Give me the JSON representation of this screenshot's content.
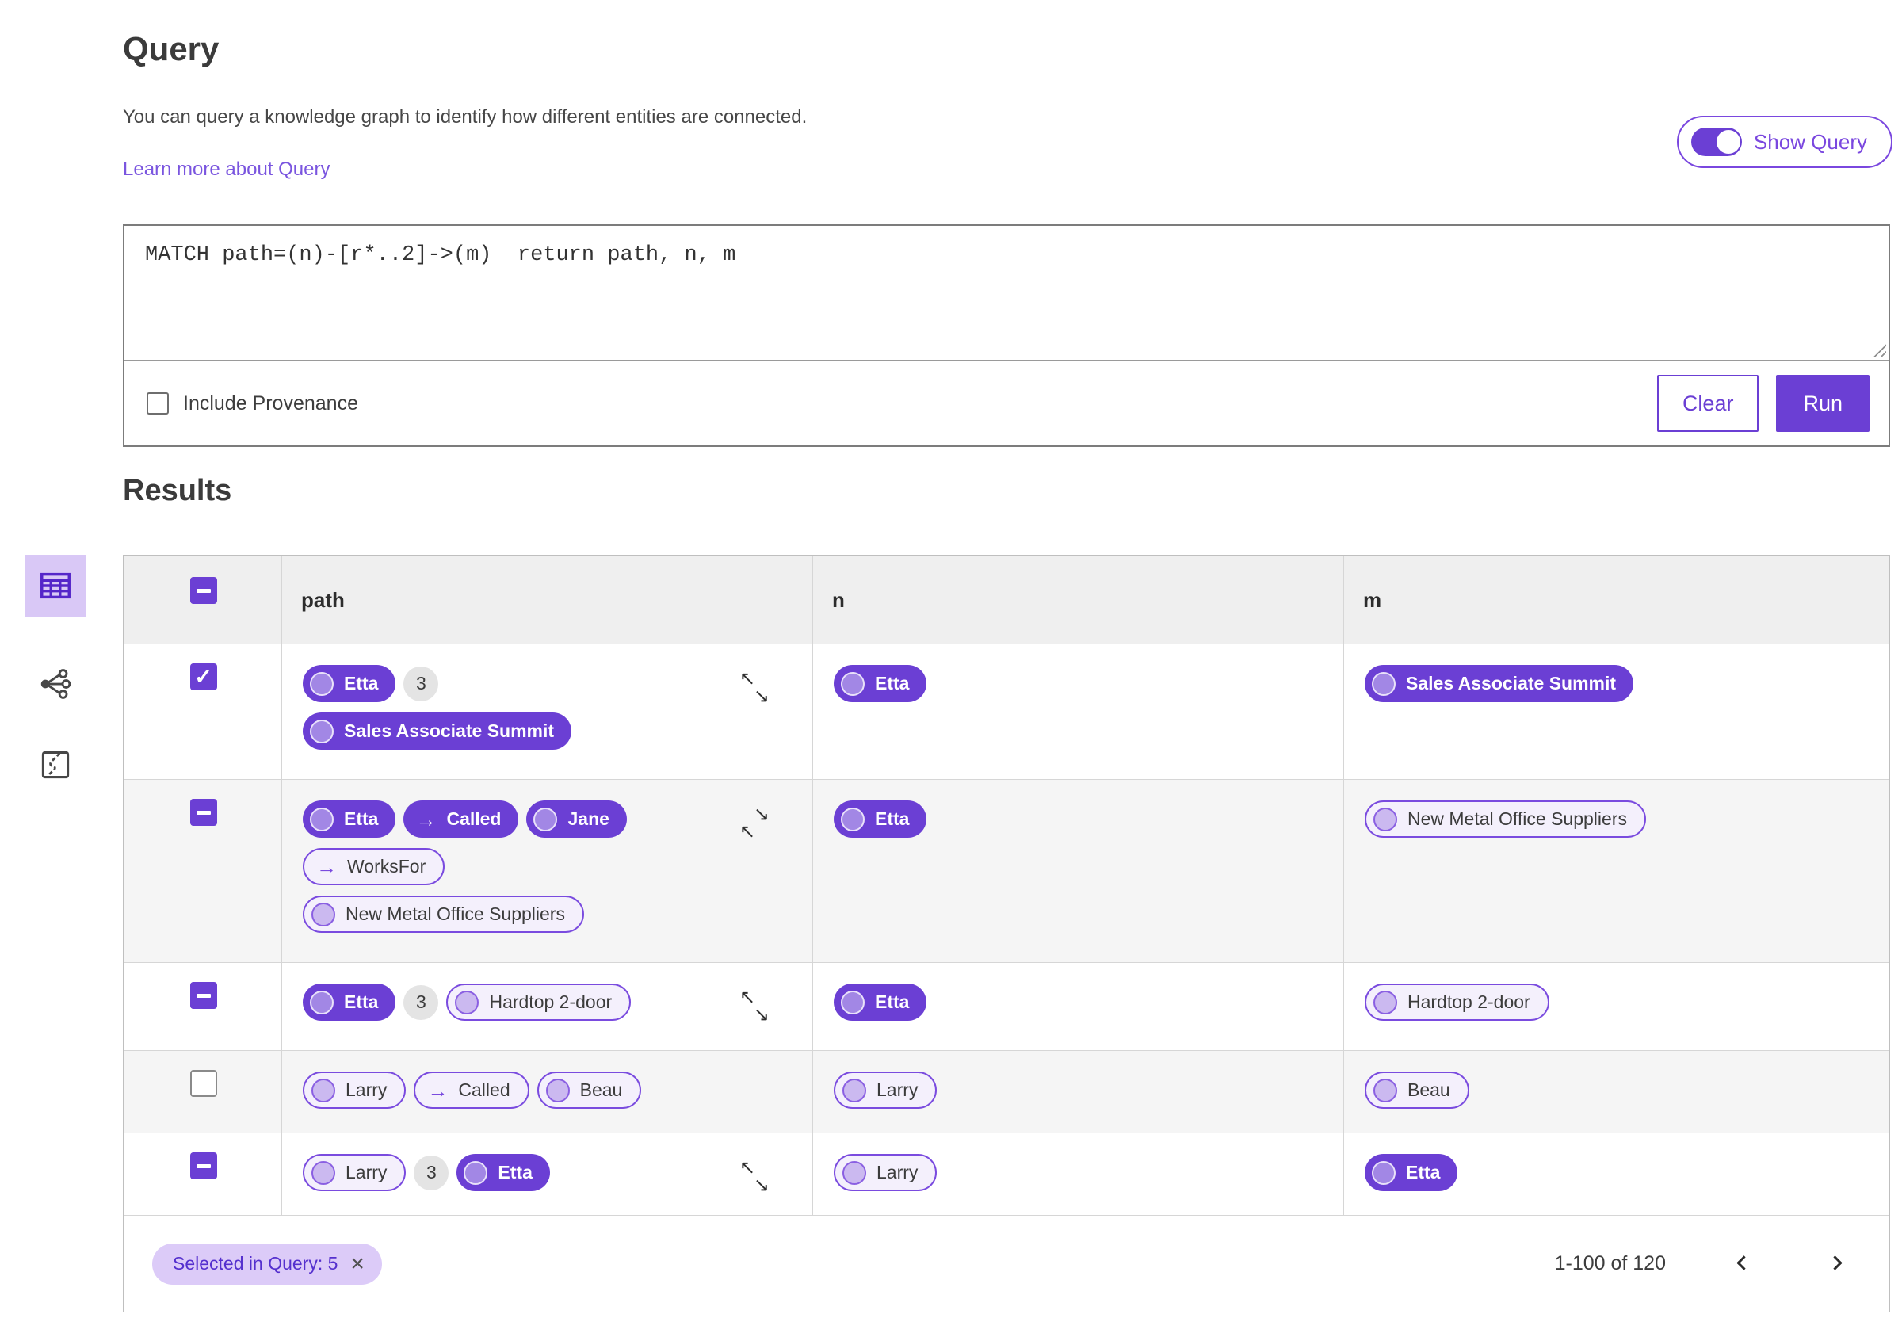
{
  "header": {
    "title": "Query",
    "description": "You can query a knowledge graph to identify how different entities are connected.",
    "learn_more": "Learn more about Query",
    "show_query_label": "Show Query",
    "show_query_on": true
  },
  "query_editor": {
    "text": "MATCH path=(n)-[r*..2]->(m)  return path, n, m",
    "include_provenance_label": "Include Provenance",
    "include_provenance_checked": false,
    "clear_label": "Clear",
    "run_label": "Run"
  },
  "results": {
    "title": "Results",
    "active_view": "table-view",
    "view_modes": [
      "table-view",
      "graph-view",
      "map-view"
    ],
    "columns": [
      "path",
      "n",
      "m"
    ],
    "header_checkbox": "indeterminate",
    "rows": [
      {
        "checkbox": "checked",
        "path_lines": [
          [
            {
              "t": "node",
              "v": "filled",
              "label": "Etta"
            },
            {
              "t": "count",
              "label": "3"
            }
          ],
          [
            {
              "t": "node",
              "v": "filled",
              "label": "Sales Associate Summit"
            }
          ]
        ],
        "resize_icon": "expand",
        "n": {
          "t": "node",
          "v": "filled",
          "label": "Etta"
        },
        "m": {
          "t": "node",
          "v": "filled",
          "label": "Sales Associate Summit"
        }
      },
      {
        "checkbox": "indeterminate",
        "path_lines": [
          [
            {
              "t": "node",
              "v": "filled",
              "label": "Etta"
            },
            {
              "t": "edge",
              "v": "filled",
              "label": "Called"
            },
            {
              "t": "node",
              "v": "filled",
              "label": "Jane"
            }
          ],
          [
            {
              "t": "edge",
              "v": "outlined",
              "label": "WorksFor"
            }
          ],
          [
            {
              "t": "node",
              "v": "outlined",
              "label": "New Metal Office Suppliers"
            }
          ]
        ],
        "resize_icon": "collapse",
        "n": {
          "t": "node",
          "v": "filled",
          "label": "Etta"
        },
        "m": {
          "t": "node",
          "v": "outlined",
          "label": "New Metal Office Suppliers"
        }
      },
      {
        "checkbox": "indeterminate",
        "path_lines": [
          [
            {
              "t": "node",
              "v": "filled",
              "label": "Etta"
            },
            {
              "t": "count",
              "label": "3"
            },
            {
              "t": "node",
              "v": "outlined",
              "label": "Hardtop 2-door"
            }
          ]
        ],
        "resize_icon": "expand",
        "n": {
          "t": "node",
          "v": "filled",
          "label": "Etta"
        },
        "m": {
          "t": "node",
          "v": "outlined",
          "label": "Hardtop 2-door"
        }
      },
      {
        "checkbox": "unchecked",
        "path_lines": [
          [
            {
              "t": "node",
              "v": "outlined",
              "label": "Larry"
            },
            {
              "t": "edge",
              "v": "outlined",
              "label": "Called"
            },
            {
              "t": "node",
              "v": "outlined",
              "label": "Beau"
            }
          ]
        ],
        "resize_icon": null,
        "n": {
          "t": "node",
          "v": "outlined",
          "label": "Larry"
        },
        "m": {
          "t": "node",
          "v": "outlined",
          "label": "Beau"
        }
      },
      {
        "checkbox": "indeterminate",
        "path_lines": [
          [
            {
              "t": "node",
              "v": "outlined",
              "label": "Larry"
            },
            {
              "t": "count",
              "label": "3"
            },
            {
              "t": "node",
              "v": "filled",
              "label": "Etta"
            }
          ]
        ],
        "resize_icon": "expand",
        "n": {
          "t": "node",
          "v": "outlined",
          "label": "Larry"
        },
        "m": {
          "t": "node",
          "v": "filled",
          "label": "Etta"
        }
      },
      {
        "partial": true,
        "checkbox": "none",
        "path_lines": [
          [
            {
              "t": "node",
              "v": "outlined",
              "label": ""
            },
            {
              "t": "count",
              "label": ""
            },
            {
              "t": "node",
              "v": "outlined",
              "label": ""
            }
          ]
        ],
        "resize_icon": null,
        "n": {
          "t": "node",
          "v": "outlined",
          "label": ""
        },
        "m": {
          "t": "node",
          "v": "outlined",
          "label": ""
        }
      }
    ],
    "footer": {
      "selected_chip": "Selected in Query: 5",
      "page_range": "1-100 of 120"
    }
  },
  "icons": {
    "edge_arrow": "→",
    "check": "✓",
    "arrow_nw": "↖",
    "arrow_se": "↘",
    "dismiss": "×"
  },
  "palette": {
    "primary_purple": "#6B3FD4",
    "outline_purple": "#7A4BDF",
    "pill_light_bg": "#F4F0FC",
    "link_purple": "#7A55DF",
    "chip_bg": "#DCCBF8",
    "chip_text": "#5530CE",
    "header_row_bg": "#EFEFEF",
    "alt_row_bg": "#F5F5F5",
    "count_badge_bg": "#E4E4E4"
  }
}
